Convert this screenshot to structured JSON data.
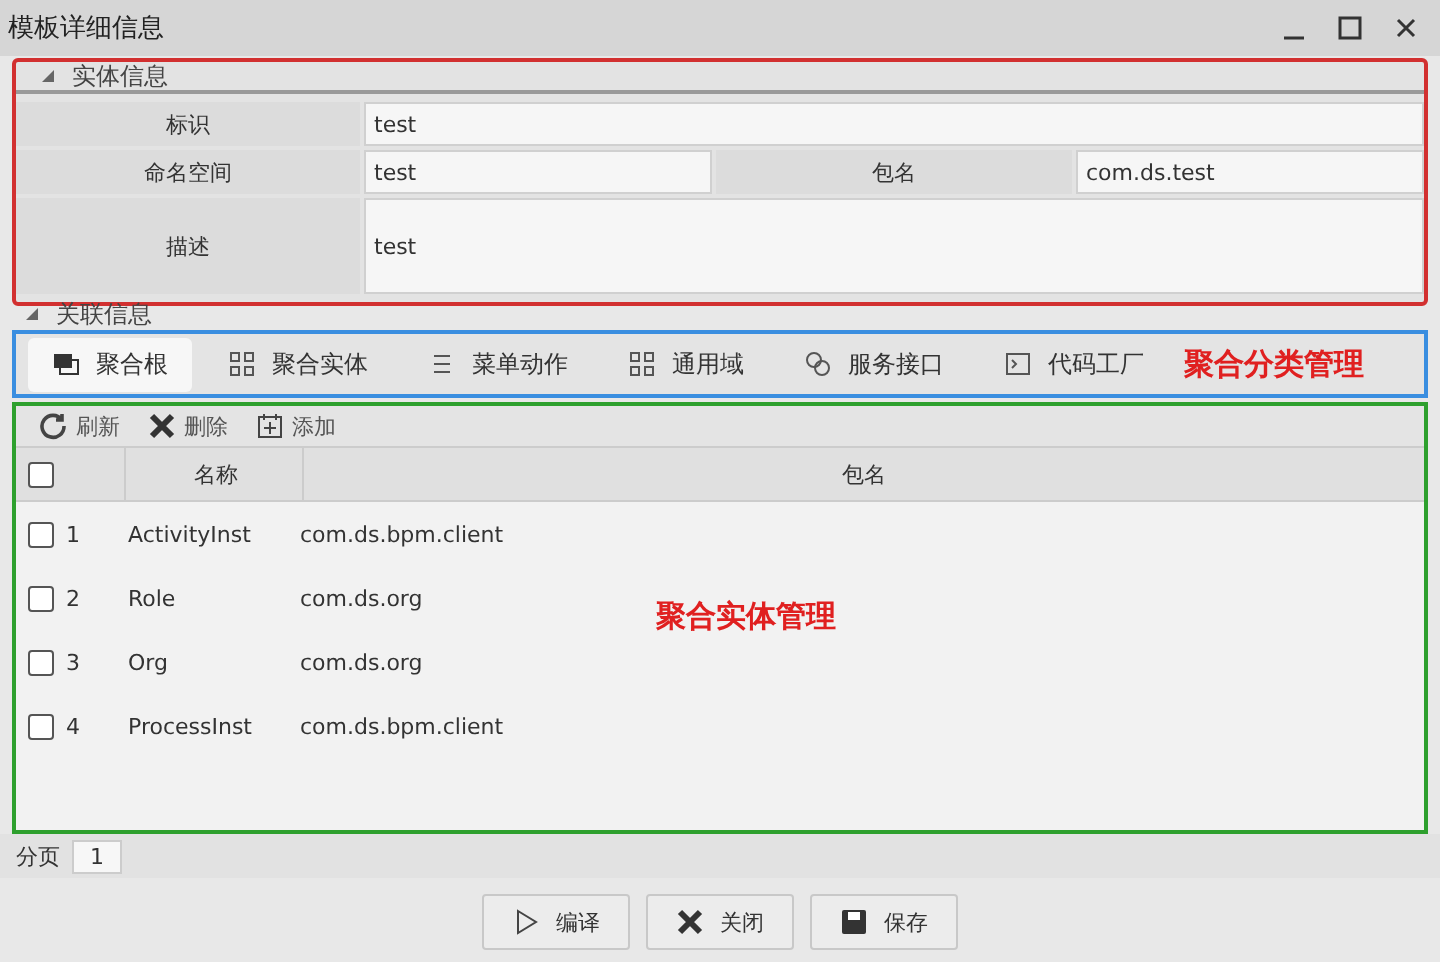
{
  "window": {
    "title": "模板详细信息"
  },
  "entity_section": {
    "title": "实体信息",
    "expanded": true,
    "fields": [
      {
        "label": "标识",
        "value": "test"
      },
      {
        "label": "命名空间",
        "value": "test"
      },
      {
        "label": "包名",
        "value": "com.ds.test"
      },
      {
        "label": "描述",
        "value": "test"
      }
    ]
  },
  "related_section": {
    "title": "关联信息",
    "expanded": true
  },
  "tabs": [
    {
      "label": "聚合根",
      "selected": true
    },
    {
      "label": "聚合实体",
      "selected": false
    },
    {
      "label": "菜单动作",
      "selected": false
    },
    {
      "label": "通用域",
      "selected": false
    },
    {
      "label": "服务接口",
      "selected": false
    },
    {
      "label": "代码工厂",
      "selected": false
    }
  ],
  "annotations": [
    "聚合分类管理",
    "聚合实体管理"
  ],
  "toolbar": [
    "刷新",
    "删除",
    "添加"
  ],
  "table": {
    "all_checked": false,
    "columns": [
      "名称",
      "包名"
    ],
    "rows": [
      {
        "index": "1",
        "name": "ActivityInst",
        "package": "com.ds.bpm.client",
        "checked": false
      },
      {
        "index": "2",
        "name": "Role",
        "package": "com.ds.org",
        "checked": false
      },
      {
        "index": "3",
        "name": "Org",
        "package": "com.ds.org",
        "checked": false
      },
      {
        "index": "4",
        "name": "ProcessInst",
        "package": "com.ds.bpm.client",
        "checked": false
      }
    ]
  },
  "pager": {
    "label": "分页",
    "page": "1"
  },
  "buttons": [
    "编译",
    "关闭",
    "保存"
  ]
}
